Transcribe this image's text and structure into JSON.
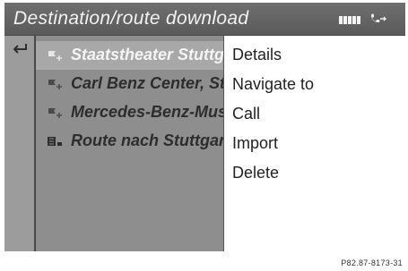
{
  "header": {
    "title": "Destination/route download",
    "signal_bars": 5
  },
  "list": {
    "items": [
      {
        "label": "Staatstheater Stuttgart",
        "icon": "destination-flag-icon",
        "selected": true
      },
      {
        "label": "Carl Benz Center, Stuttgart",
        "icon": "destination-flag-icon",
        "selected": false
      },
      {
        "label": "Mercedes-Benz-Museum",
        "icon": "destination-flag-icon",
        "selected": false
      },
      {
        "label": "Route nach Stuttgart",
        "icon": "route-icon",
        "selected": false
      }
    ]
  },
  "menu": {
    "items": [
      {
        "label": "Details",
        "selected": true
      },
      {
        "label": "Navigate to",
        "selected": false
      },
      {
        "label": "Call",
        "selected": false
      },
      {
        "label": "Import",
        "selected": false
      },
      {
        "label": "Delete",
        "selected": false
      }
    ]
  },
  "caption": "P82.87-8173-31"
}
